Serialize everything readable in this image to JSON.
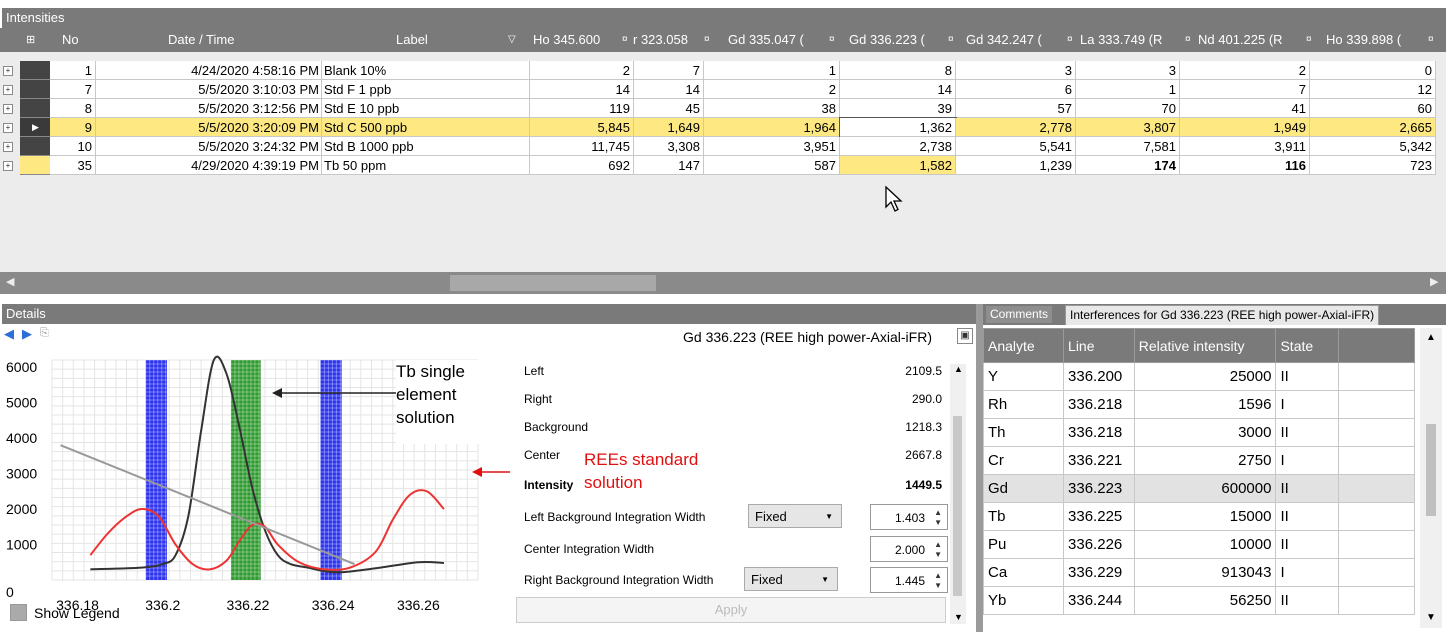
{
  "intensities": {
    "title": "Intensities",
    "columns": {
      "no": "No",
      "datetime": "Date / Time",
      "label": "Label",
      "c1": "Ho 345.600",
      "c2": "r 323.058",
      "c3": "Gd 335.047 (",
      "c4": "Gd 336.223 (",
      "c5": "Gd 342.247 (",
      "c6": "La 333.749 (R",
      "c7": "Nd 401.225 (R",
      "c8": "Ho 339.898 ("
    },
    "rows": [
      {
        "no": "1",
        "datetime": "4/24/2020 4:58:16 PM",
        "label": "Blank 10%",
        "v": [
          "2",
          "7",
          "1",
          "8",
          "3",
          "3",
          "2",
          "0"
        ]
      },
      {
        "no": "7",
        "datetime": "5/5/2020 3:10:03 PM",
        "label": "Std F 1 ppb",
        "v": [
          "14",
          "14",
          "2",
          "14",
          "6",
          "1",
          "7",
          "12"
        ]
      },
      {
        "no": "8",
        "datetime": "5/5/2020 3:12:56 PM",
        "label": "Std E 10 ppb",
        "v": [
          "119",
          "45",
          "38",
          "39",
          "57",
          "70",
          "41",
          "60"
        ]
      },
      {
        "no": "9",
        "datetime": "5/5/2020 3:20:09 PM",
        "label": "Std C 500 ppb",
        "v": [
          "5,845",
          "1,649",
          "1,964",
          "1,362",
          "2,778",
          "3,807",
          "1,949",
          "2,665"
        ]
      },
      {
        "no": "10",
        "datetime": "5/5/2020 3:24:32 PM",
        "label": "Std B 1000 ppb",
        "v": [
          "11,745",
          "3,308",
          "3,951",
          "2,738",
          "5,541",
          "7,581",
          "3,911",
          "5,342"
        ]
      },
      {
        "no": "35",
        "datetime": "4/29/2020 4:39:19 PM",
        "label": "Tb 50 ppm",
        "v": [
          "692",
          "147",
          "587",
          "1,582",
          "1,239",
          "174",
          "116",
          "723"
        ]
      }
    ]
  },
  "details": {
    "title": "Details",
    "line_title": "Gd 336.223 (REE high power-Axial-iFR)",
    "show_legend": "Show Legend",
    "params": {
      "left_label": "Left",
      "left_value": "2109.5",
      "right_label": "Right",
      "right_value": "290.0",
      "background_label": "Background",
      "background_value": "1218.3",
      "center_label": "Center",
      "center_value": "2667.8",
      "intensity_label": "Intensity",
      "intensity_value": "1449.5",
      "lbiw_label": "Left Background Integration Width",
      "lbiw_mode": "Fixed",
      "lbiw_value": "1.403",
      "ciw_label": "Center Integration Width",
      "ciw_value": "2.000",
      "rbiw_label": "Right Background Integration Width",
      "rbiw_mode": "Fixed",
      "rbiw_value": "1.445"
    },
    "apply_label": "Apply",
    "callout_tb": "Tb single element solution",
    "callout_ree": "REEs standard solution"
  },
  "chart_data": {
    "type": "line",
    "x_ticks": [
      "336.18",
      "336.2",
      "336.22",
      "336.24",
      "336.26"
    ],
    "y_ticks": [
      "6000",
      "5000",
      "4000",
      "3000",
      "2000",
      "1000",
      "0"
    ],
    "xlim": [
      336.174,
      336.274
    ],
    "ylim": [
      0,
      6200
    ],
    "series": [
      {
        "color": "#333333",
        "x": [
          336.183,
          336.195,
          336.2,
          336.203,
          336.206,
          336.209,
          336.212,
          336.215,
          336.218,
          336.221,
          336.224,
          336.227,
          336.23,
          336.234,
          336.238,
          336.242,
          336.25,
          336.26,
          336.266
        ],
        "y": [
          300,
          350,
          450,
          700,
          1800,
          4200,
          6200,
          5800,
          4300,
          2600,
          1400,
          700,
          450,
          350,
          250,
          220,
          330,
          500,
          480
        ]
      },
      {
        "color": "#ee3333",
        "x": [
          336.183,
          336.187,
          336.191,
          336.195,
          336.199,
          336.203,
          336.207,
          336.211,
          336.215,
          336.218,
          336.221,
          336.224,
          336.227,
          336.232,
          336.238,
          336.244,
          336.25,
          336.254,
          336.258,
          336.262,
          336.266
        ],
        "y": [
          700,
          1300,
          1750,
          2000,
          1800,
          1000,
          450,
          300,
          550,
          1100,
          1550,
          1500,
          1000,
          500,
          300,
          350,
          800,
          1700,
          2400,
          2500,
          2000
        ]
      },
      {
        "color": "#999999",
        "x": [
          336.176,
          336.245
        ],
        "y": [
          3800,
          450
        ]
      }
    ],
    "bands": [
      {
        "color": "#2d34ee",
        "x0": 336.196,
        "x1": 336.201
      },
      {
        "color": "#2f9a2f",
        "x0": 336.216,
        "x1": 336.223
      },
      {
        "color": "#2d34ee",
        "x0": 336.237,
        "x1": 336.242
      }
    ]
  },
  "right": {
    "tabs": [
      "Comments",
      "Interferences for Gd 336.223 (REE high power-Axial-iFR)"
    ],
    "columns": [
      "Analyte",
      "Line",
      "Relative intensity",
      "State"
    ],
    "rows": [
      [
        "Y",
        "336.200",
        "25000",
        "II"
      ],
      [
        "Rh",
        "336.218",
        "1596",
        "I"
      ],
      [
        "Th",
        "336.218",
        "3000",
        "II"
      ],
      [
        "Cr",
        "336.221",
        "2750",
        "I"
      ],
      [
        "Gd",
        "336.223",
        "600000",
        "II"
      ],
      [
        "Tb",
        "336.225",
        "15000",
        "II"
      ],
      [
        "Pu",
        "336.226",
        "10000",
        "II"
      ],
      [
        "Ca",
        "336.229",
        "913043",
        "I"
      ],
      [
        "Yb",
        "336.244",
        "56250",
        "II"
      ]
    ]
  }
}
